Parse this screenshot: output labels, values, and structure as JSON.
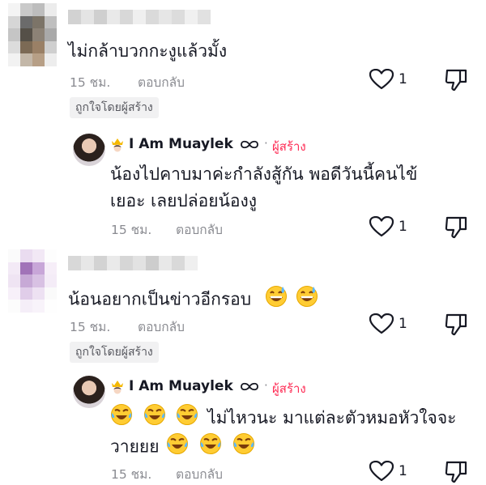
{
  "comments": [
    {
      "text": "ไม่กล้าบวกกะงูแล้วมั้ง",
      "time": "15 ชม.",
      "reply_label": "ตอบกลับ",
      "likes": "1",
      "liked_by_creator": "ถูกใจโดยผู้สร้าง",
      "reply": {
        "author": "I Am Muaylek",
        "creator_tag": "ผู้สร้าง",
        "separator": "·",
        "line1": "น้องไปคาบมาค่ะกำลังสู้กัน พอดีวันนี้คนไข้",
        "line2": "เยอะ เลยปล่อยน้องงู",
        "time": "15 ชม.",
        "reply_label": "ตอบกลับ",
        "likes": "1"
      }
    },
    {
      "text": "น้อนอยากเป็นข่าวอีกรอบ",
      "time": "15 ชม.",
      "reply_label": "ตอบกลับ",
      "likes": "1",
      "liked_by_creator": "ถูกใจโดยผู้สร้าง",
      "reply": {
        "author": "I Am Muaylek",
        "creator_tag": "ผู้สร้าง",
        "separator": "·",
        "line1": "ไม่ไหวนะ มาแต่ละตัวหมอหัวใจจะ",
        "line2": "วายยย",
        "time": "15 ชม.",
        "reply_label": "ตอบกลับ",
        "likes": "1"
      }
    }
  ],
  "colors": {
    "creator": "#fe2c55",
    "meta": "#8a8b91",
    "badge_bg": "#f1f1f2"
  },
  "icons": [
    "heart-outline-icon",
    "dislike-icon",
    "crown-icon",
    "infinity-icon",
    "sweat-smile-emoji",
    "tears-of-joy-emoji"
  ]
}
